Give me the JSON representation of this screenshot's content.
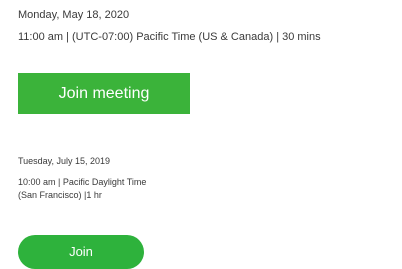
{
  "invite_a": {
    "date": "Monday, May 18, 2020",
    "time_details": "11:00 am  |  (UTC-07:00) Pacific Time (US & Canada)  |  30 mins",
    "join_label": "Join meeting",
    "join_color": "#3bb33a"
  },
  "invite_b": {
    "date": "Tuesday, July 15, 2019",
    "time_line1": "10:00 am | Pacific Daylight Time",
    "time_line2": "(San Francisco) |1 hr",
    "join_label": "Join",
    "join_color": "#2eb23c"
  }
}
